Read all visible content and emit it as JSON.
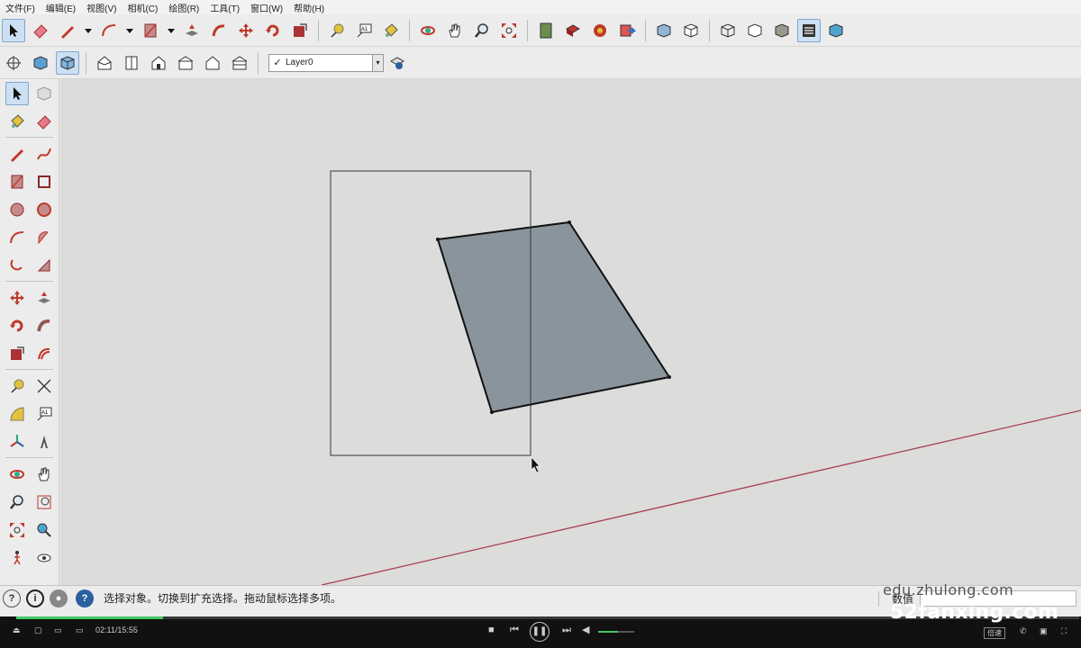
{
  "menu": {
    "items": [
      "文件(F)",
      "编辑(E)",
      "视图(V)",
      "相机(C)",
      "绘图(R)",
      "工具(T)",
      "窗口(W)",
      "帮助(H)"
    ]
  },
  "layer": {
    "name": "Layer0",
    "check": "✓",
    "dropdown": "▾"
  },
  "status": {
    "message": "选择对象。切换到扩充选择。拖动鼠标选择多项。",
    "vcb_label": "数值",
    "vcb_value": ""
  },
  "watermarks": {
    "top": "edu.zhulong.com",
    "bottom": "52fanxing.com"
  },
  "player": {
    "time": "02:11/15:55",
    "progress": 0.138,
    "volume": 0.55,
    "speed_label": "倍速"
  },
  "colors": {
    "face": "#8a949c",
    "selection_box": "#333333",
    "red_axis": "#a8404f",
    "accent_green": "#41c864"
  }
}
